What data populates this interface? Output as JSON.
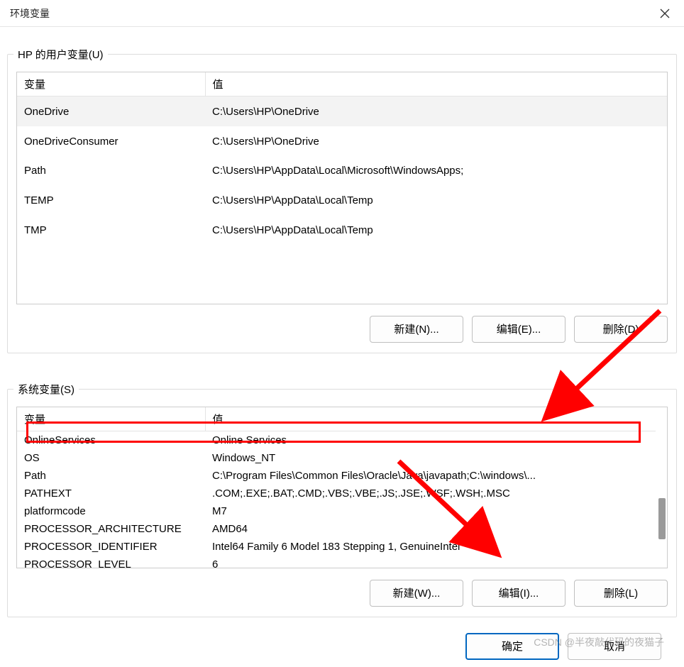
{
  "window": {
    "title": "环境变量"
  },
  "user_group": {
    "legend": "HP 的用户变量(U)",
    "col_name": "变量",
    "col_value": "值",
    "rows": [
      {
        "name": "OneDrive",
        "value": "C:\\Users\\HP\\OneDrive",
        "selected": true
      },
      {
        "name": "OneDriveConsumer",
        "value": "C:\\Users\\HP\\OneDrive"
      },
      {
        "name": "Path",
        "value": "C:\\Users\\HP\\AppData\\Local\\Microsoft\\WindowsApps;"
      },
      {
        "name": "TEMP",
        "value": "C:\\Users\\HP\\AppData\\Local\\Temp"
      },
      {
        "name": "TMP",
        "value": "C:\\Users\\HP\\AppData\\Local\\Temp"
      }
    ],
    "buttons": {
      "new": "新建(N)...",
      "edit": "编辑(E)...",
      "delete": "删除(D)"
    }
  },
  "sys_group": {
    "legend": "系统变量(S)",
    "col_name": "变量",
    "col_value": "值",
    "rows": [
      {
        "name": "OnlineServices",
        "value": "Online Services"
      },
      {
        "name": "OS",
        "value": "Windows_NT"
      },
      {
        "name": "Path",
        "value": "C:\\Program Files\\Common Files\\Oracle\\Java\\javapath;C:\\windows\\...",
        "highlight": true
      },
      {
        "name": "PATHEXT",
        "value": ".COM;.EXE;.BAT;.CMD;.VBS;.VBE;.JS;.JSE;.WSF;.WSH;.MSC"
      },
      {
        "name": "platformcode",
        "value": "M7"
      },
      {
        "name": "PROCESSOR_ARCHITECTURE",
        "value": "AMD64"
      },
      {
        "name": "PROCESSOR_IDENTIFIER",
        "value": "Intel64 Family 6 Model 183 Stepping 1, GenuineIntel"
      },
      {
        "name": "PROCESSOR_LEVEL",
        "value": "6"
      }
    ],
    "buttons": {
      "new": "新建(W)...",
      "edit": "编辑(I)...",
      "delete": "删除(L)"
    }
  },
  "dialog_buttons": {
    "ok": "确定",
    "cancel": "取消"
  },
  "watermark": "CSDN @半夜敲代码的夜猫子"
}
